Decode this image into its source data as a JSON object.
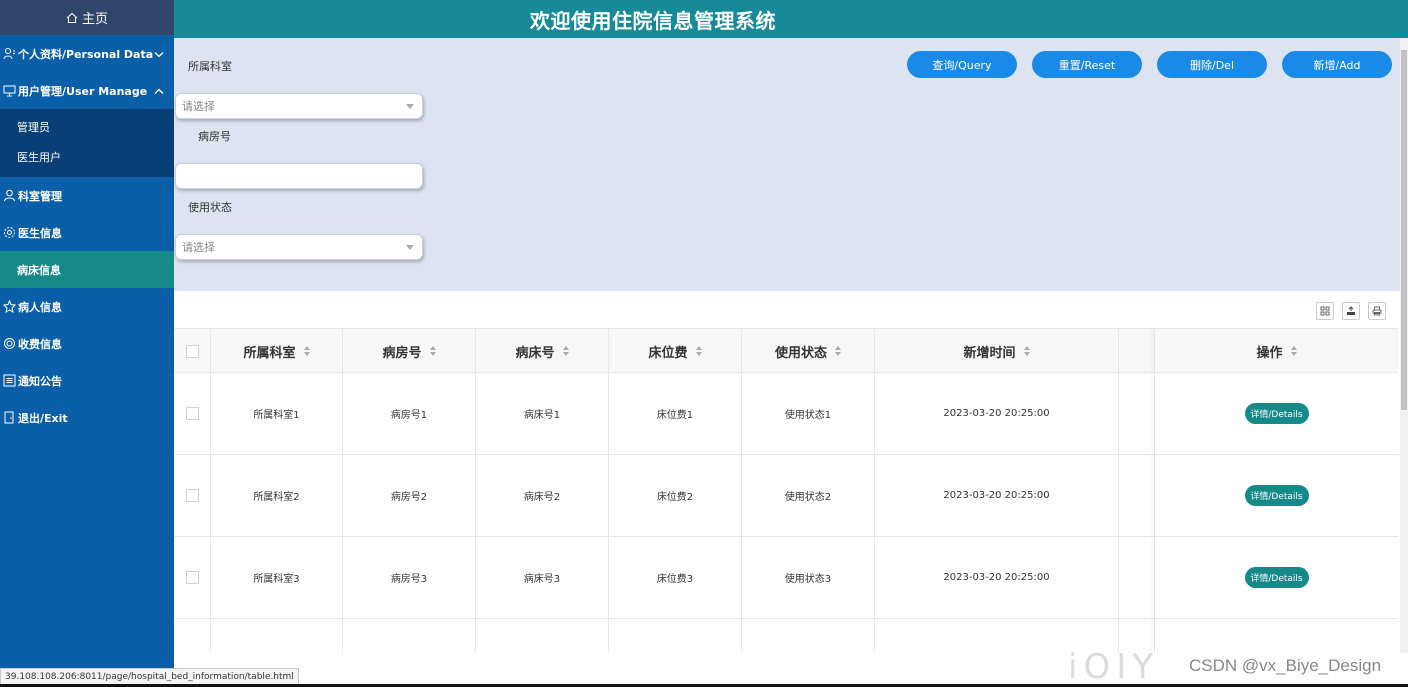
{
  "sidebar": {
    "home_label": "主页",
    "items": [
      {
        "label": "个人资料/Personal Data",
        "icon": "person-card-icon"
      },
      {
        "label": "用户管理/User Manage",
        "icon": "monitor-icon"
      },
      {
        "label": "科室管理",
        "icon": "user-icon"
      },
      {
        "label": "医生信息",
        "icon": "gear-icon"
      },
      {
        "label": "病床信息"
      },
      {
        "label": "病人信息",
        "icon": "badge-icon"
      },
      {
        "label": "收费信息",
        "icon": "target-icon"
      },
      {
        "label": "通知公告",
        "icon": "list-icon"
      },
      {
        "label": "退出/Exit",
        "icon": "door-icon"
      }
    ],
    "submenu": [
      "管理员",
      "医生用户"
    ]
  },
  "header": {
    "title": "欢迎使用住院信息管理系统"
  },
  "filter": {
    "dept_label": "所属科室",
    "dept_placeholder": "请选择",
    "room_label": "病房号",
    "room_value": "",
    "status_label": "使用状态",
    "status_placeholder": "请选择",
    "buttons": {
      "query": "查询/Query",
      "reset": "重置/Reset",
      "delete": "删除/Del",
      "add": "新增/Add"
    }
  },
  "table": {
    "columns": [
      "所属科室",
      "病房号",
      "病床号",
      "床位费",
      "使用状态",
      "新增时间",
      "操作"
    ],
    "rows": [
      {
        "dept": "所属科室1",
        "room": "病房号1",
        "bed": "病床号1",
        "fee": "床位费1",
        "status": "使用状态1",
        "time": "2023-03-20 20:25:00",
        "action": "详情/Details"
      },
      {
        "dept": "所属科室2",
        "room": "病房号2",
        "bed": "病床号2",
        "fee": "床位费2",
        "status": "使用状态2",
        "time": "2023-03-20 20:25:00",
        "action": "详情/Details"
      },
      {
        "dept": "所属科室3",
        "room": "病房号3",
        "bed": "病床号3",
        "fee": "床位费3",
        "status": "使用状态3",
        "time": "2023-03-20 20:25:00",
        "action": "详情/Details"
      }
    ]
  },
  "status_bar": {
    "url": "39.108.108.206:8011/page/hospital_bed_information/table.html"
  },
  "watermark": {
    "letters": "iOIY",
    "text": "CSDN @vx_Biye_Design"
  },
  "colors": {
    "sidebar": "#0b5ea8",
    "header": "#168a99",
    "active": "#168a89",
    "button": "#1a8ae8",
    "filter_bg": "#dde3f0"
  }
}
